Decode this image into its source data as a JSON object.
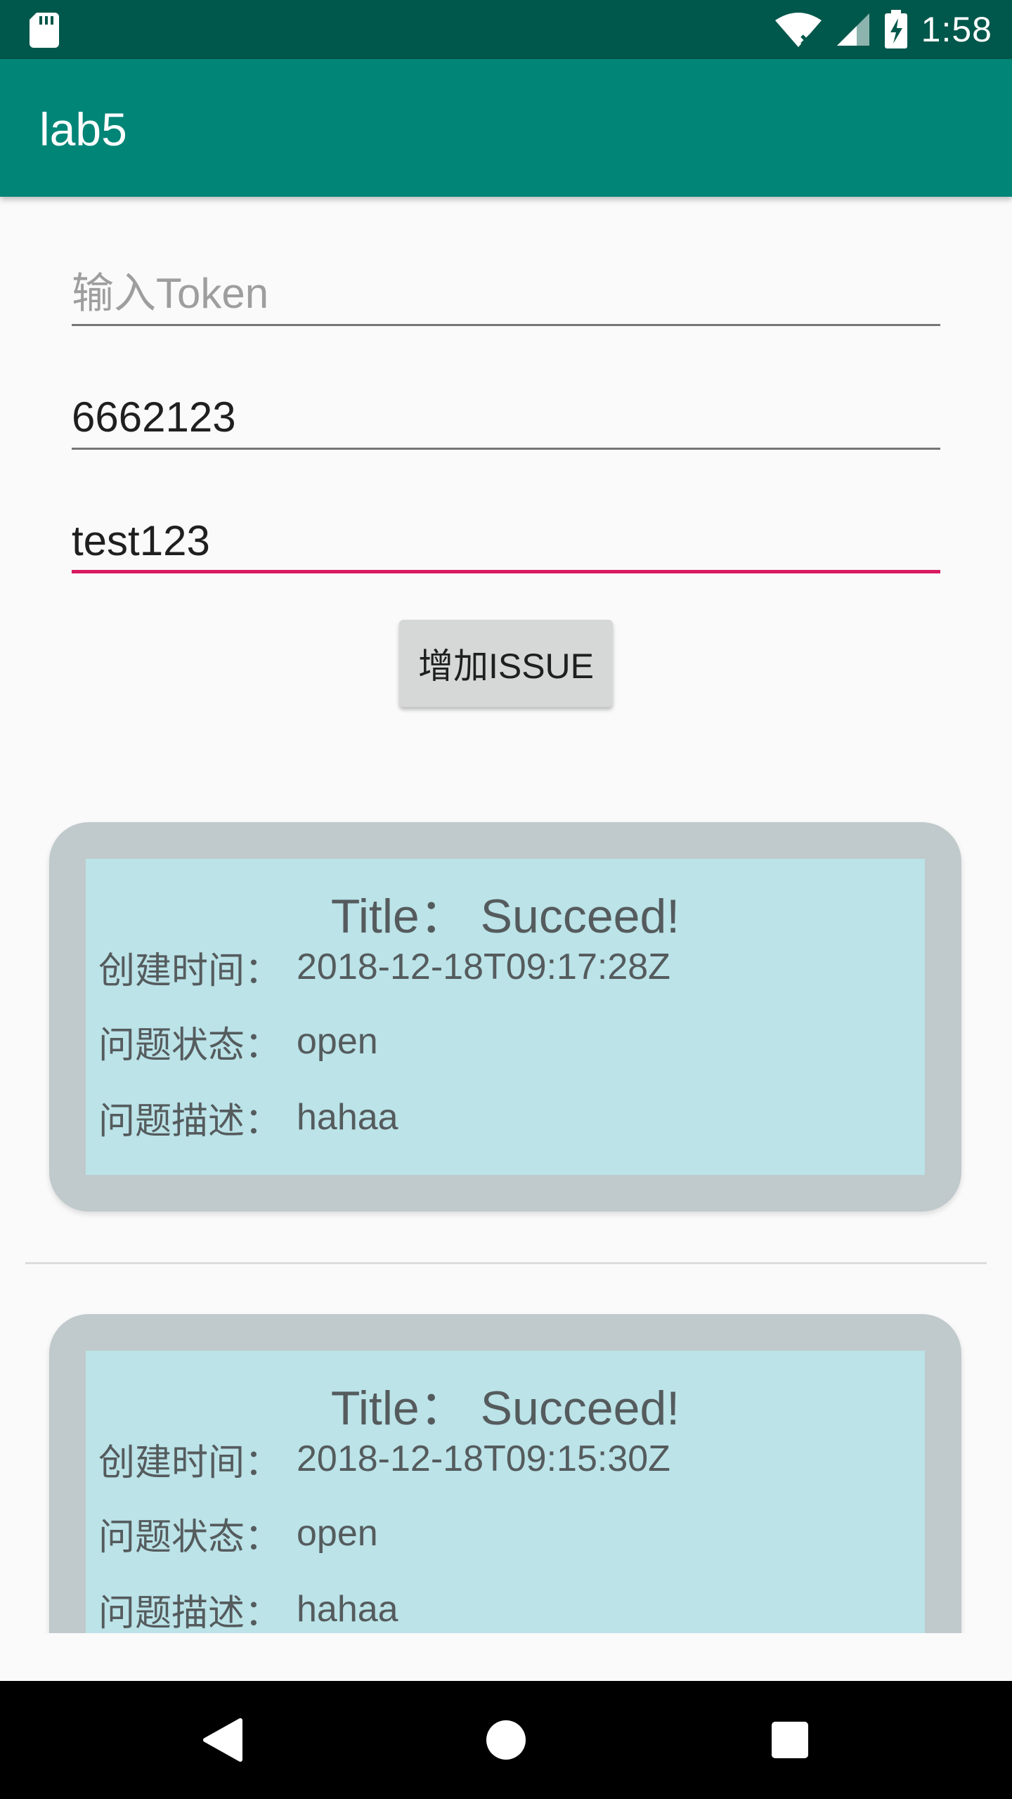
{
  "status_bar": {
    "time": "1:58",
    "icons": [
      "sd-card-icon",
      "wifi-icon",
      "signal-icon",
      "battery-charging-icon"
    ]
  },
  "app_bar": {
    "title": "lab5"
  },
  "form": {
    "token": {
      "placeholder": "输入Token",
      "value": ""
    },
    "field2": {
      "value": "6662123"
    },
    "field3": {
      "value": "test123"
    },
    "add_button_label": "增加ISSUE"
  },
  "issues": [
    {
      "title": "Title：  Succeed!",
      "created_label": "创建时间：",
      "created_value": "2018-12-18T09:17:28Z",
      "state_label": "问题状态：",
      "state_value": "open",
      "desc_label": "问题描述：",
      "desc_value": "hahaa"
    },
    {
      "title": "Title：  Succeed!",
      "created_label": "创建时间：",
      "created_value": "2018-12-18T09:15:30Z",
      "state_label": "问题状态：",
      "state_value": "open",
      "desc_label": "问题描述：",
      "desc_value": "hahaa"
    }
  ],
  "nav": [
    "back-icon",
    "home-icon",
    "recents-icon"
  ],
  "colors": {
    "status_bar": "#00574b",
    "app_bar": "#008577",
    "accent": "#d81b60",
    "card_outer": "#c0c9cb",
    "card_inner": "#bbe3e8"
  }
}
